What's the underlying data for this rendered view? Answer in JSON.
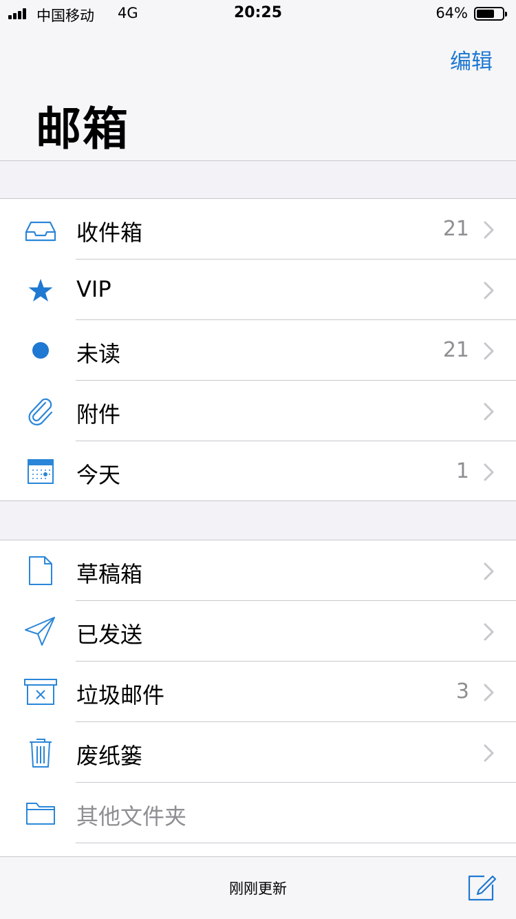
{
  "status_bar": {
    "carrier": "中国移动",
    "network": "4G",
    "time": "20:25",
    "battery_pct": "64%",
    "battery_level": 0.64
  },
  "header": {
    "edit_label": "编辑",
    "title": "邮箱"
  },
  "mailboxes": [
    {
      "label": "收件箱",
      "count": "21",
      "icon": "inbox-tray-icon"
    },
    {
      "label": "VIP",
      "count": "",
      "icon": "star-icon"
    },
    {
      "label": "未读",
      "count": "21",
      "icon": "unread-dot-icon"
    },
    {
      "label": "附件",
      "count": "",
      "icon": "paperclip-icon"
    },
    {
      "label": "今天",
      "count": "1",
      "icon": "calendar-icon"
    }
  ],
  "folders": [
    {
      "label": "草稿箱",
      "count": "",
      "icon": "document-icon"
    },
    {
      "label": "已发送",
      "count": "",
      "icon": "paper-plane-icon"
    },
    {
      "label": "垃圾邮件",
      "count": "3",
      "icon": "junk-box-icon"
    },
    {
      "label": "废纸篓",
      "count": "",
      "icon": "trash-icon"
    },
    {
      "label": "其他文件夹",
      "count": "",
      "icon": "folder-icon"
    }
  ],
  "toolbar": {
    "status_text": "刚刚更新",
    "compose_icon": "compose-icon"
  },
  "colors": {
    "accent": "#1f78d1",
    "icon_blue": "#2a86d8",
    "secondary_text": "#8e8e93",
    "separator": "#c8c7cc"
  }
}
